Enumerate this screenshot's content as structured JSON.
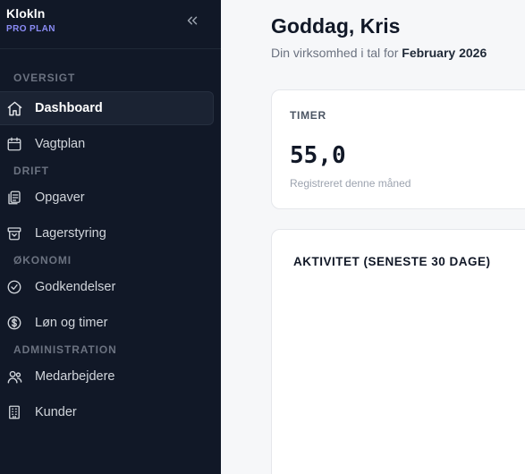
{
  "brand": {
    "name": "Klokln",
    "plan": "PRO PLAN"
  },
  "sidebar": {
    "sections": [
      {
        "label": "OVERSIGT"
      },
      {
        "label": "DRIFT"
      },
      {
        "label": "ØKONOMI"
      },
      {
        "label": "ADMINISTRATION"
      }
    ],
    "items": [
      {
        "label": "Dashboard",
        "icon": "home-icon",
        "active": true
      },
      {
        "label": "Vagtplan",
        "icon": "calendar-icon"
      },
      {
        "label": "Opgaver",
        "icon": "clipboard-icon"
      },
      {
        "label": "Lagerstyring",
        "icon": "archive-box-icon"
      },
      {
        "label": "Godkendelser",
        "icon": "check-circle-icon"
      },
      {
        "label": "Løn og timer",
        "icon": "dollar-circle-icon"
      },
      {
        "label": "Medarbejdere",
        "icon": "users-icon"
      },
      {
        "label": "Kunder",
        "icon": "building-icon"
      }
    ]
  },
  "header": {
    "greeting": "Goddag, Kris",
    "subtitle_prefix": "Din virksomhed i tal for",
    "period": "February 2026"
  },
  "cards": {
    "hours": {
      "label": "TIMER",
      "value": "55,0",
      "note": "Registreret denne måned"
    },
    "activity": {
      "title": "AKTIVITET (SENESTE 30 DAGE)"
    }
  },
  "colors": {
    "sidebar_bg": "#111827",
    "accent_plan": "#8b8cf6",
    "active_item_bg": "#1b2333"
  }
}
